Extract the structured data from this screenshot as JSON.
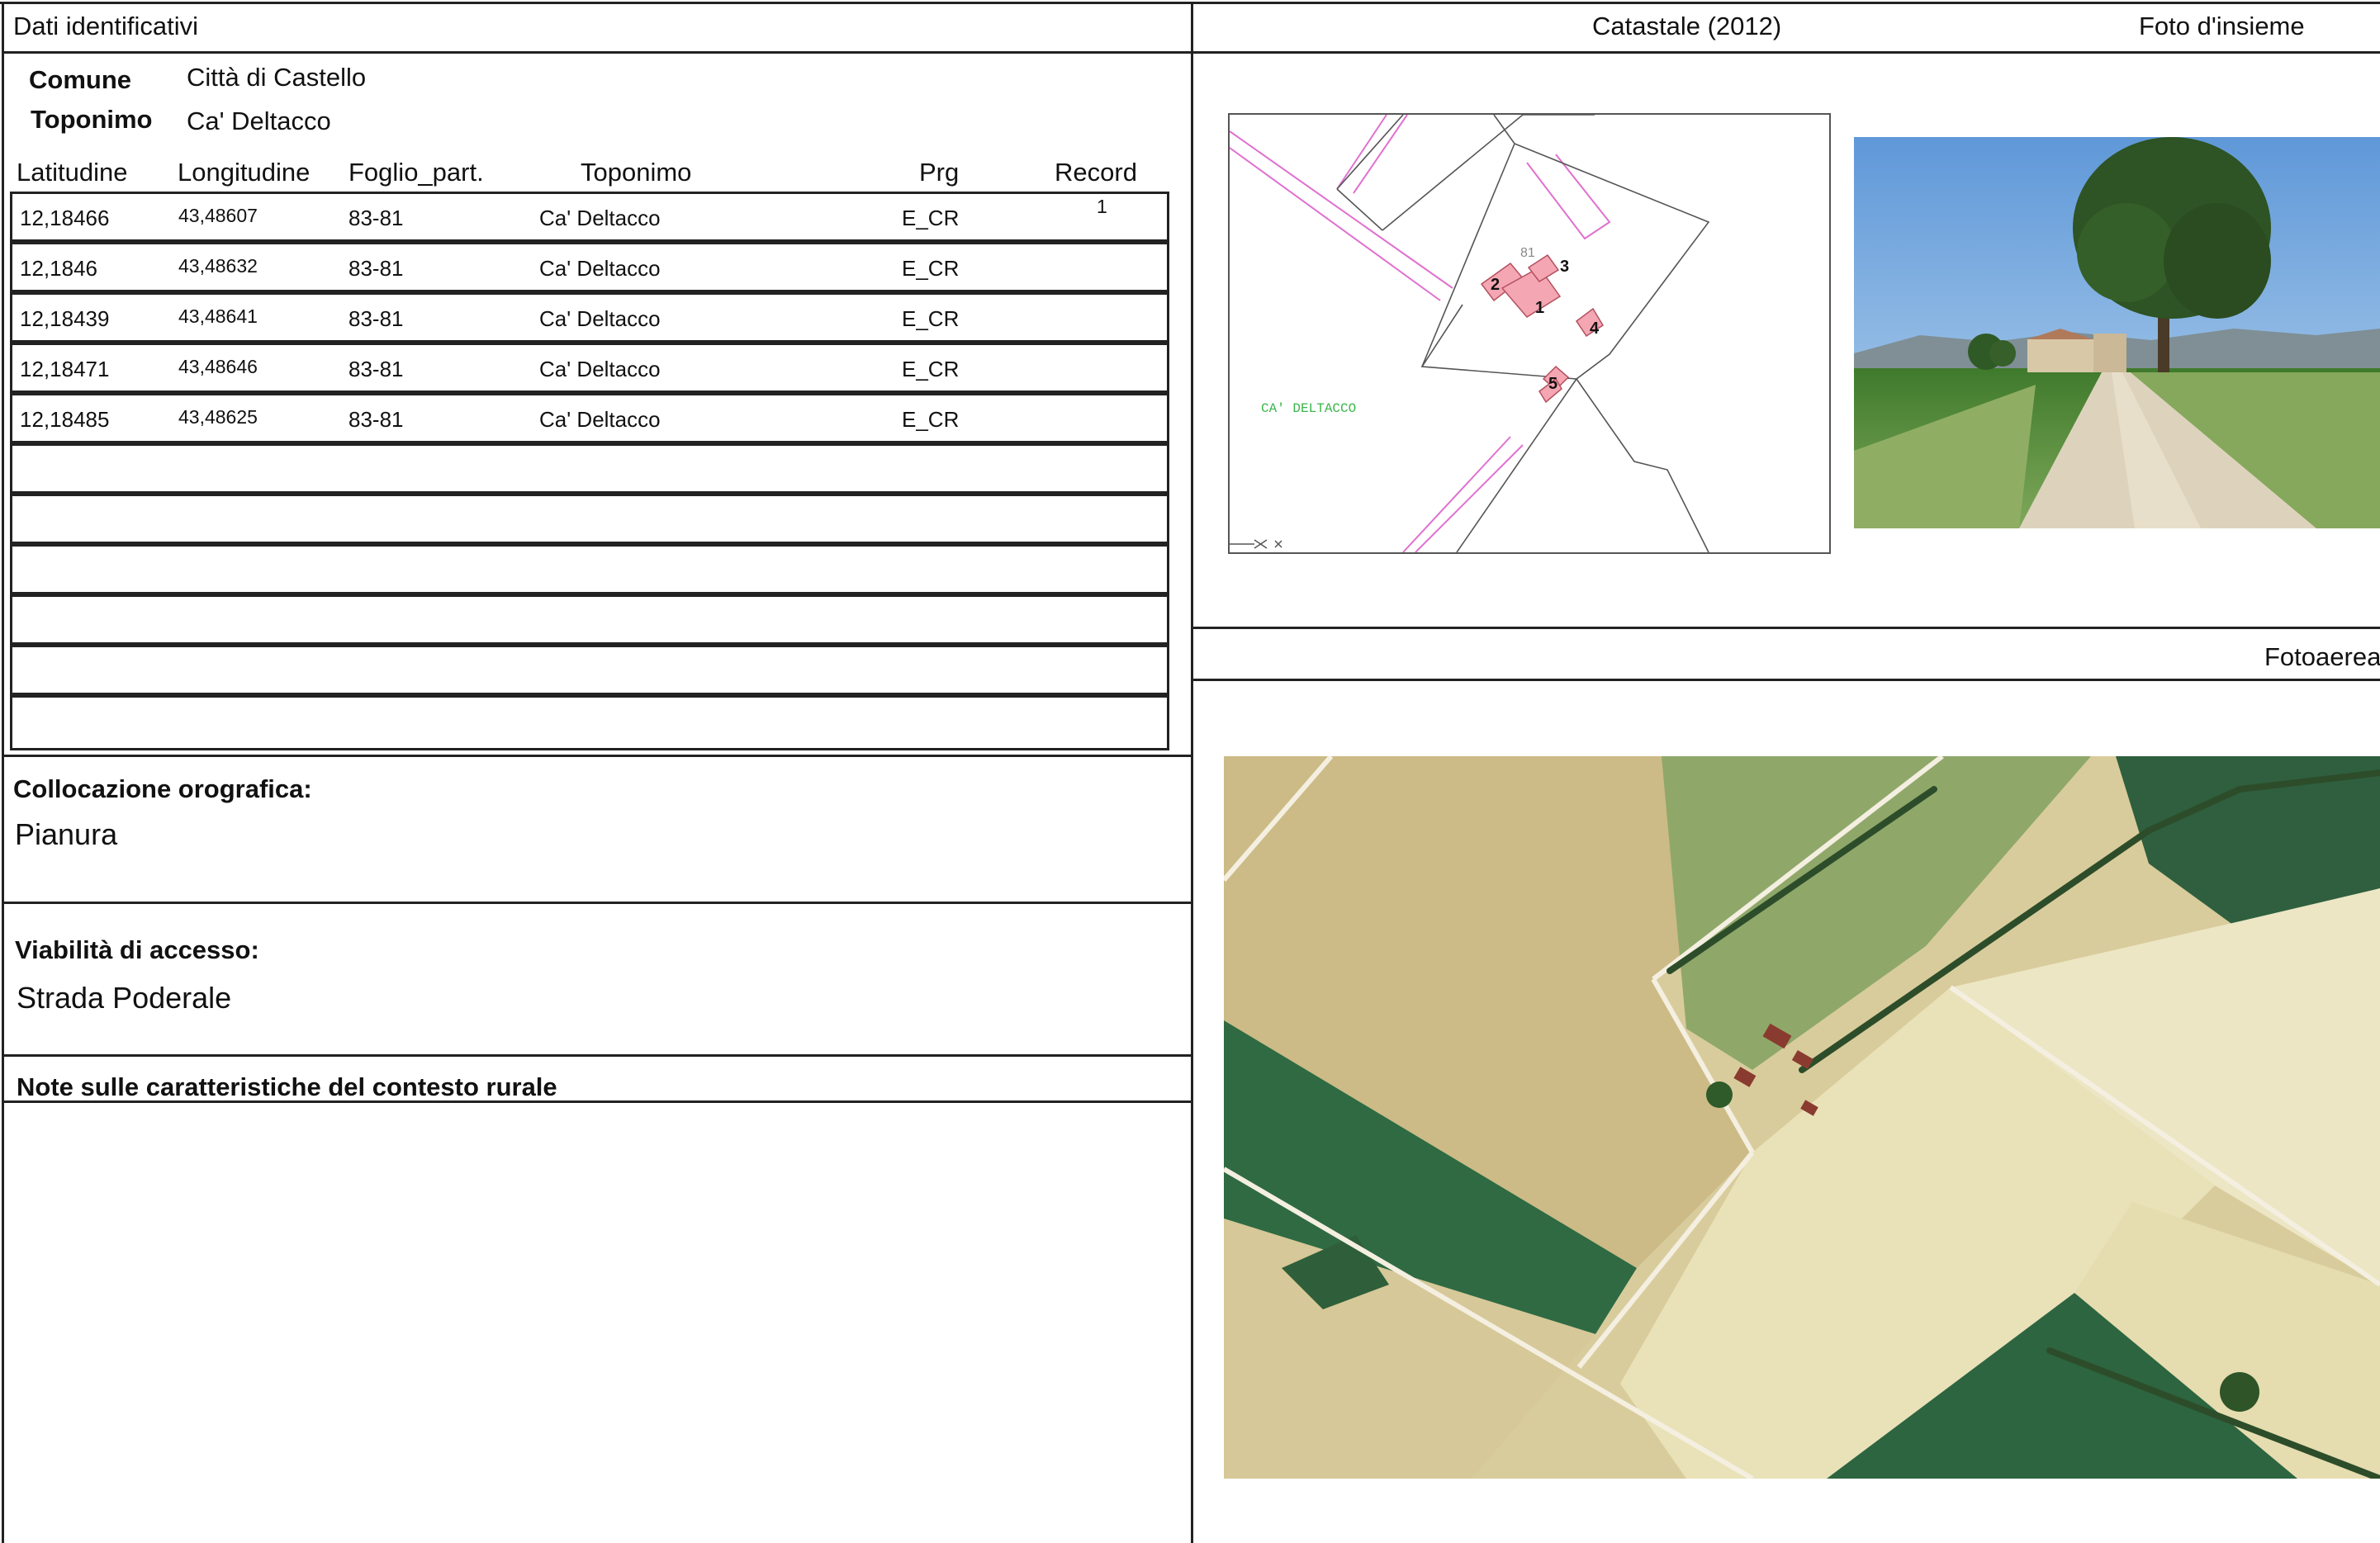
{
  "left": {
    "header": "Dati identificativi",
    "comune_label": "Comune",
    "comune_value": "Città di Castello",
    "toponimo_label": "Toponimo",
    "toponimo_value": "Ca' Deltacco",
    "table": {
      "columns": [
        "Latitudine",
        "Longitudine",
        "Foglio_part.",
        "Toponimo",
        "Prg",
        "Record"
      ],
      "rows": [
        [
          "12,18466",
          "43,48607",
          "83-81",
          "Ca' Deltacco",
          "E_CR",
          "1"
        ],
        [
          "12,1846",
          "43,48632",
          "83-81",
          "Ca' Deltacco",
          "E_CR",
          ""
        ],
        [
          "12,18439",
          "43,48641",
          "83-81",
          "Ca' Deltacco",
          "E_CR",
          ""
        ],
        [
          "12,18471",
          "43,48646",
          "83-81",
          "Ca' Deltacco",
          "E_CR",
          ""
        ],
        [
          "12,18485",
          "43,48625",
          "83-81",
          "Ca' Deltacco",
          "E_CR",
          ""
        ],
        [
          "",
          "",
          "",
          "",
          "",
          ""
        ],
        [
          "",
          "",
          "",
          "",
          "",
          ""
        ],
        [
          "",
          "",
          "",
          "",
          "",
          ""
        ],
        [
          "",
          "",
          "",
          "",
          "",
          ""
        ],
        [
          "",
          "",
          "",
          "",
          "",
          ""
        ],
        [
          "",
          "",
          "",
          "",
          "",
          ""
        ]
      ]
    },
    "collocazione_label": "Collocazione orografica:",
    "collocazione_value": "Pianura",
    "viabilita_label": "Viabilità di accesso:",
    "viabilita_value": "Strada Poderale",
    "note_label": "Note sulle caratteristiche del contesto rurale"
  },
  "right": {
    "catastale_header": "Catastale (2012)",
    "foto_header": "Foto d'insieme",
    "fotoaerea_header": "Fotoaerea",
    "map": {
      "parcel_number": "81",
      "place_label": "CA' DELTACCO",
      "building_labels": [
        "1",
        "2",
        "3",
        "4",
        "5"
      ]
    }
  },
  "colors": {
    "building_fill": "#f4a6b2",
    "map_line_pink": "#e070d0",
    "place_label_green": "#3ab54a",
    "sky": "#7fb0e0",
    "field_green": "#4f8a3a",
    "road": "#d9cfbd",
    "aerial_beige": "#e6ddb6",
    "aerial_dark_green": "#2f5d3a"
  }
}
